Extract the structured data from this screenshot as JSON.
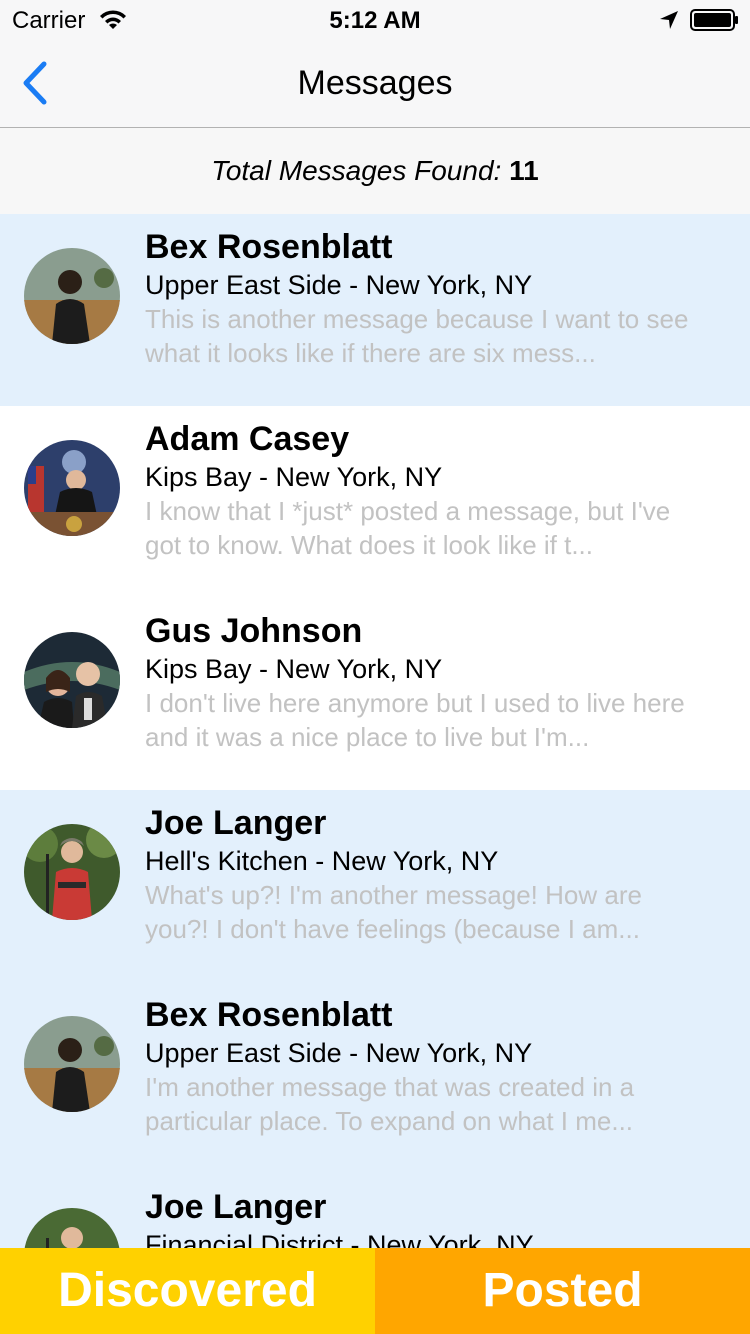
{
  "status_bar": {
    "carrier": "Carrier",
    "time": "5:12 AM"
  },
  "nav": {
    "title": "Messages",
    "back_icon": "chevron-left-icon",
    "accent_color": "#1a7cf4"
  },
  "summary": {
    "label": "Total Messages Found:",
    "count": "11"
  },
  "messages": [
    {
      "name": "Bex Rosenblatt",
      "location": "Upper East Side - New York, NY",
      "preview": "This is another message because I want to see what it looks like if there are six mess...",
      "highlighted": true
    },
    {
      "name": "Adam Casey",
      "location": "Kips Bay - New York, NY",
      "preview": "I know that I *just* posted a message, but I've got to know. What does it look like if t...",
      "highlighted": false
    },
    {
      "name": "Gus Johnson",
      "location": "Kips Bay - New York, NY",
      "preview": "I don't live here anymore but I used to live here and it was a nice place to live but I'm...",
      "highlighted": false
    },
    {
      "name": "Joe Langer",
      "location": "Hell's Kitchen - New York, NY",
      "preview": "What's up?! I'm another message! How are you?! I don't have feelings (because I am...",
      "highlighted": true
    },
    {
      "name": "Bex Rosenblatt",
      "location": "Upper East Side - New York, NY",
      "preview": "I'm another message that was created in a particular place. To expand on what I  me...",
      "highlighted": true
    },
    {
      "name": "Joe Langer",
      "location": "Financial District - New York, NY",
      "preview": "",
      "highlighted": true
    }
  ],
  "tabs": {
    "discovered": "Discovered",
    "posted": "Posted",
    "discovered_color": "#ffd100",
    "posted_color": "#ffa600"
  }
}
